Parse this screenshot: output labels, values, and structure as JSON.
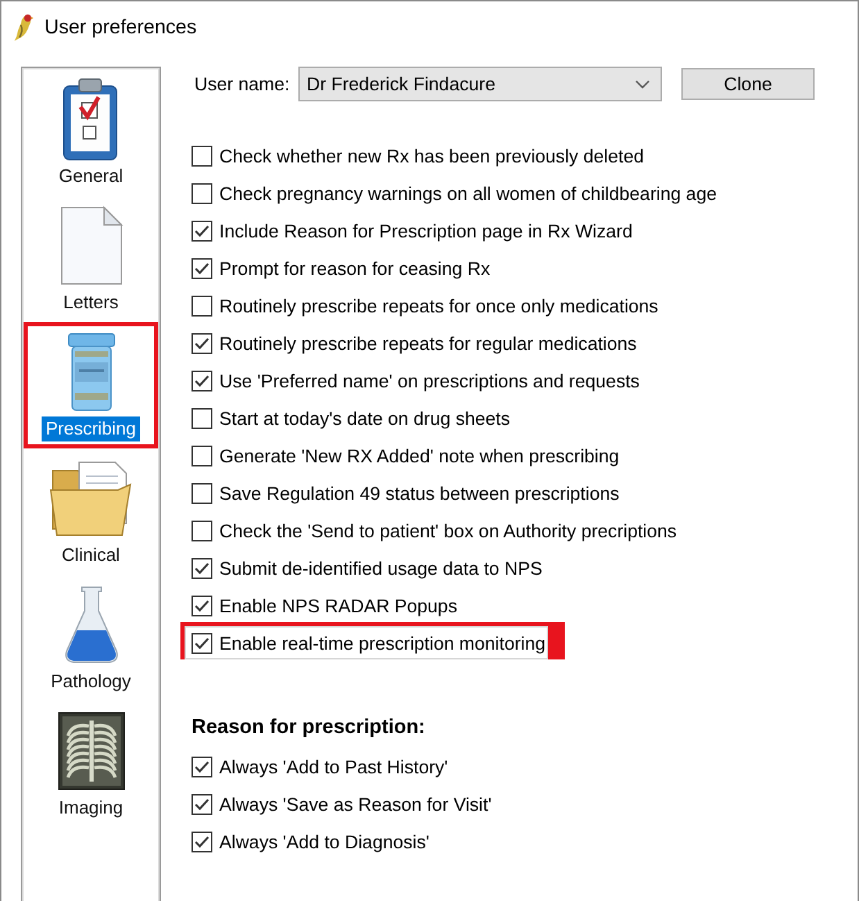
{
  "window": {
    "title": "User preferences"
  },
  "sidebar": {
    "items": [
      {
        "label": "General",
        "kind": "clipboard",
        "selected": false,
        "highlighted": false
      },
      {
        "label": "Letters",
        "kind": "document",
        "selected": false,
        "highlighted": false
      },
      {
        "label": "Prescribing",
        "kind": "bottle",
        "selected": true,
        "highlighted": true
      },
      {
        "label": "Clinical",
        "kind": "folder",
        "selected": false,
        "highlighted": false
      },
      {
        "label": "Pathology",
        "kind": "flask",
        "selected": false,
        "highlighted": false
      },
      {
        "label": "Imaging",
        "kind": "xray",
        "selected": false,
        "highlighted": false
      }
    ]
  },
  "user": {
    "label": "User name:",
    "value": "Dr Frederick Findacure"
  },
  "clone_button": {
    "label": "Clone"
  },
  "options": [
    {
      "label": "Check whether new Rx has been previously deleted",
      "checked": false,
      "highlighted": false
    },
    {
      "label": "Check pregnancy warnings on all women of childbearing age",
      "checked": false,
      "highlighted": false
    },
    {
      "label": "Include Reason for Prescription page in Rx Wizard",
      "checked": true,
      "highlighted": false
    },
    {
      "label": "Prompt for reason for ceasing Rx",
      "checked": true,
      "highlighted": false
    },
    {
      "label": "Routinely prescribe repeats for once only medications",
      "checked": false,
      "highlighted": false
    },
    {
      "label": "Routinely prescribe repeats for regular medications",
      "checked": true,
      "highlighted": false
    },
    {
      "label": "Use 'Preferred name' on prescriptions and requests",
      "checked": true,
      "highlighted": false
    },
    {
      "label": "Start at today's date on drug sheets",
      "checked": false,
      "highlighted": false
    },
    {
      "label": "Generate 'New RX Added' note when prescribing",
      "checked": false,
      "highlighted": false
    },
    {
      "label": "Save Regulation 49 status between prescriptions",
      "checked": false,
      "highlighted": false
    },
    {
      "label": "Check the 'Send to patient' box on Authority precriptions",
      "checked": false,
      "highlighted": false
    },
    {
      "label": "Submit de-identified usage data to NPS",
      "checked": true,
      "highlighted": false
    },
    {
      "label": "Enable NPS RADAR Popups",
      "checked": true,
      "highlighted": false
    },
    {
      "label": "Enable real-time prescription monitoring",
      "checked": true,
      "highlighted": true
    }
  ],
  "reason_for_prescription": {
    "heading": "Reason for prescription:",
    "options": [
      {
        "label": "Always 'Add to Past History'",
        "checked": true
      },
      {
        "label": "Always 'Save as Reason for Visit'",
        "checked": true
      },
      {
        "label": "Always 'Add to Diagnosis'",
        "checked": true
      }
    ]
  }
}
